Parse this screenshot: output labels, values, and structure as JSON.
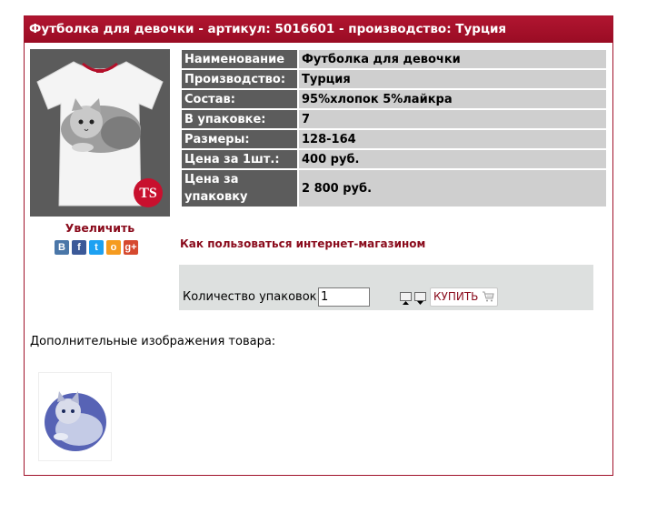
{
  "header": {
    "title": "Футболка для девочки - артикул: 5016601 - производство: Турция"
  },
  "product": {
    "zoom_label": "Увеличить",
    "specs": [
      {
        "key": "Наименование",
        "value": "Футболка для девочки"
      },
      {
        "key": "Производство:",
        "value": "Турция"
      },
      {
        "key": "Состав:",
        "value": "95%хлопок 5%лайкра"
      },
      {
        "key": "В упаковке:",
        "value": "7"
      },
      {
        "key": "Размеры:",
        "value": "128-164"
      },
      {
        "key": "Цена за 1шт.:",
        "value": "400 руб."
      },
      {
        "key": "Цена за упаковку",
        "value": "2 800 руб."
      }
    ],
    "logo_text": "TS"
  },
  "share": {
    "buttons": [
      {
        "name": "vk",
        "label": "В",
        "color": "#4a76a8"
      },
      {
        "name": "facebook",
        "label": "f",
        "color": "#3b5998"
      },
      {
        "name": "twitter",
        "label": "t",
        "color": "#1da1f2"
      },
      {
        "name": "odnoklassniki",
        "label": "о",
        "color": "#f59b1f"
      },
      {
        "name": "google-plus",
        "label": "g+",
        "color": "#d6492f"
      }
    ]
  },
  "links": {
    "howto": "Как пользоваться интернет-магазином"
  },
  "order": {
    "qty_label": "Количество упаковок:",
    "qty_value": "1",
    "buy_label": "КУПИТЬ"
  },
  "gallery": {
    "label": "Дополнительные изображения товара:"
  },
  "colors": {
    "accent": "#9a0c24",
    "link": "#8a0b1c",
    "spec_key_bg": "#5c5c5c",
    "spec_value_bg": "#cfcfcf",
    "order_bg": "#dde0df"
  }
}
